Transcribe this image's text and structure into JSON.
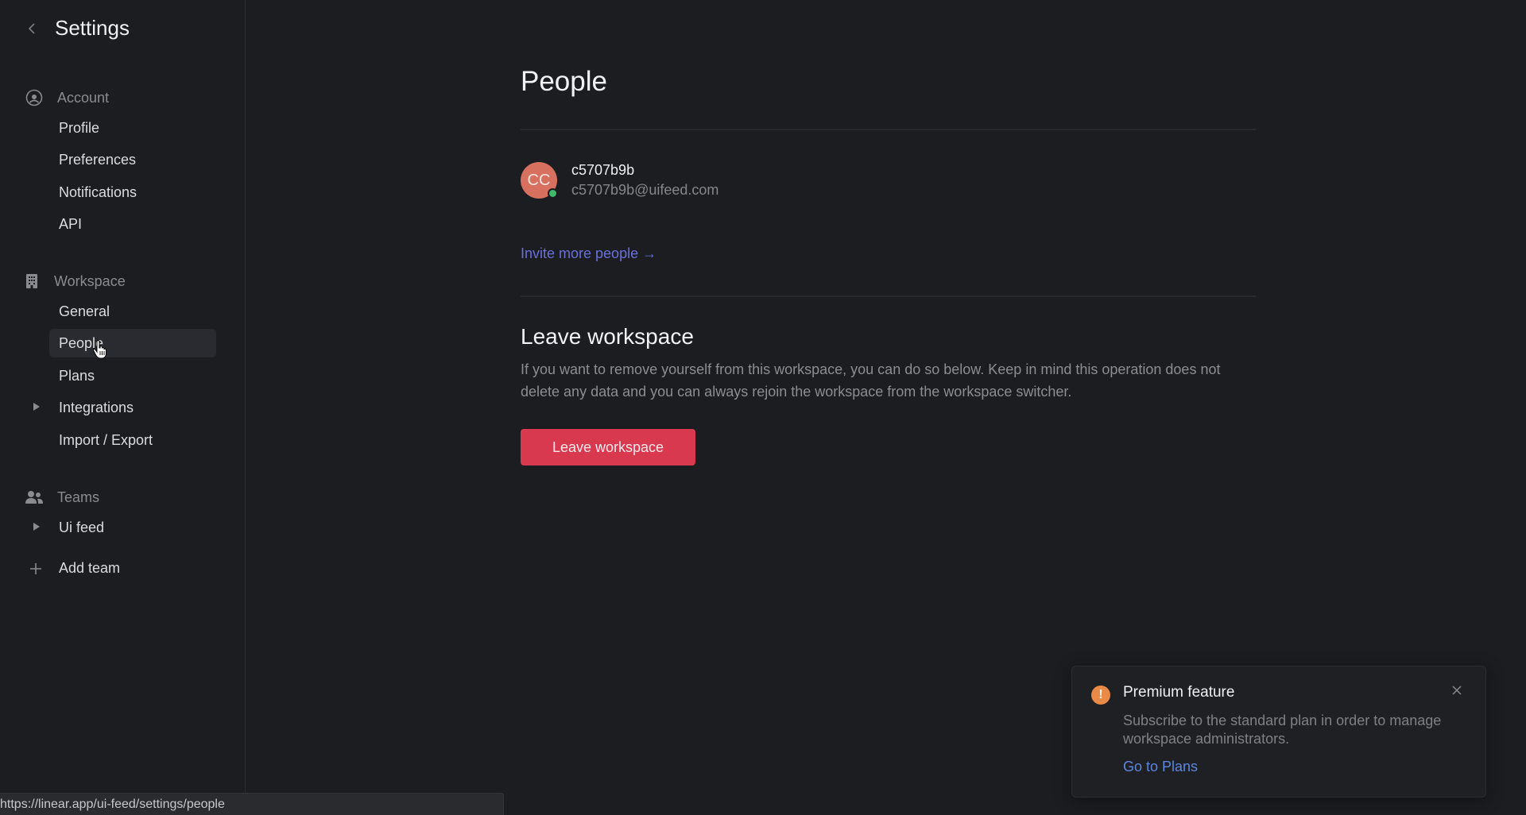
{
  "sidebar": {
    "title": "Settings",
    "sections": {
      "account": {
        "label": "Account",
        "icon": "user-circle-icon",
        "items": [
          {
            "label": "Profile"
          },
          {
            "label": "Preferences"
          },
          {
            "label": "Notifications"
          },
          {
            "label": "API"
          }
        ]
      },
      "workspace": {
        "label": "Workspace",
        "icon": "building-icon",
        "items": [
          {
            "label": "General"
          },
          {
            "label": "People",
            "active": true
          },
          {
            "label": "Plans"
          },
          {
            "label": "Integrations",
            "expandable": true
          },
          {
            "label": "Import / Export"
          }
        ]
      },
      "teams": {
        "label": "Teams",
        "icon": "users-icon",
        "items": [
          {
            "label": "Ui feed",
            "expandable": true
          }
        ]
      }
    },
    "add_team_label": "Add team"
  },
  "main": {
    "title": "People",
    "member": {
      "initials": "CC",
      "name": "c5707b9b",
      "email": "c5707b9b@uifeed.com",
      "status": "online"
    },
    "invite_link": "Invite more people →",
    "leave": {
      "title": "Leave workspace",
      "description": "If you want to remove yourself from this workspace, you can do so below. Keep in mind this operation does not delete any data and you can always rejoin the workspace from the workspace switcher.",
      "button_label": "Leave workspace"
    }
  },
  "toast": {
    "icon": "exclamation-icon",
    "title": "Premium feature",
    "body": "Subscribe to the standard plan in order to manage workspace administrators.",
    "link": "Go to Plans"
  },
  "status_bar": {
    "url": "https://linear.app/ui-feed/settings/people"
  },
  "colors": {
    "background": "#1c1d21",
    "accent_link": "#6b6fdc",
    "danger": "#d8394e",
    "warning": "#e98a46",
    "online": "#3dbb6a",
    "avatar": "#d8705f"
  }
}
